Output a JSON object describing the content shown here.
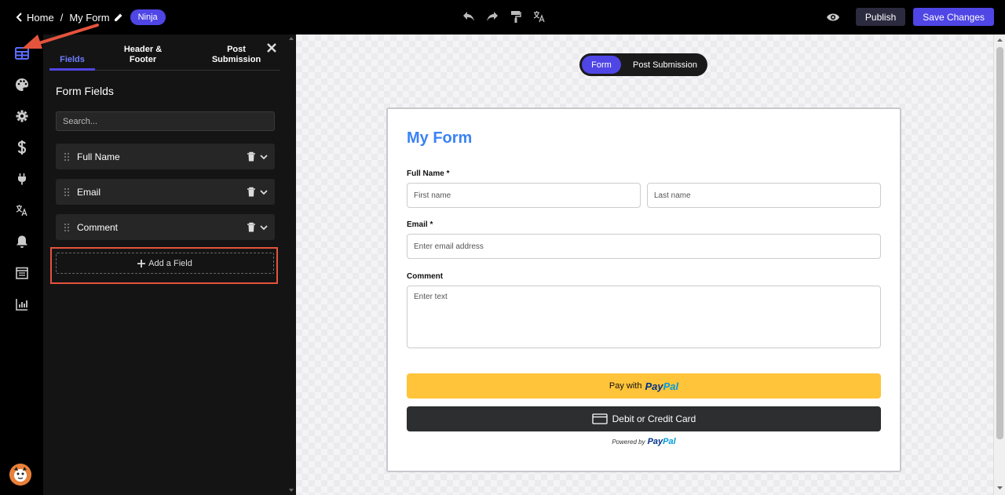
{
  "header": {
    "home_label": "Home",
    "separator": "/",
    "form_title": "My Form",
    "badge": "Ninja",
    "publish_label": "Publish",
    "save_label": "Save Changes"
  },
  "rail": {
    "icons": [
      "fields-icon",
      "palette-icon",
      "gear-icon",
      "dollar-icon",
      "plug-icon",
      "translate-icon",
      "bell-icon",
      "calendar-icon",
      "chart-icon"
    ]
  },
  "panel": {
    "tabs": [
      {
        "label": "Fields"
      },
      {
        "label": "Header &\nFooter"
      },
      {
        "label": "Post\nSubmission"
      }
    ],
    "section_title": "Form Fields",
    "search_placeholder": "Search...",
    "fields": [
      {
        "name": "Full Name"
      },
      {
        "name": "Email"
      },
      {
        "name": "Comment"
      }
    ],
    "add_field_label": "Add a Field"
  },
  "canvas": {
    "toggle_form": "Form",
    "toggle_post": "Post Submission"
  },
  "form": {
    "title": "My Form",
    "full_name_label": "Full Name *",
    "first_name_placeholder": "First name",
    "last_name_placeholder": "Last name",
    "email_label": "Email *",
    "email_placeholder": "Enter email address",
    "comment_label": "Comment",
    "comment_placeholder": "Enter text",
    "paypal_pay_with": "Pay with",
    "paypal_logo_1": "Pay",
    "paypal_logo_2": "Pal",
    "card_button": "Debit or Credit Card",
    "powered_by": "Powered by"
  },
  "colors": {
    "accent": "#4f46e5",
    "form_title": "#3b82f6",
    "paypal_yellow": "#ffc439",
    "highlight_red": "#e5533d"
  }
}
